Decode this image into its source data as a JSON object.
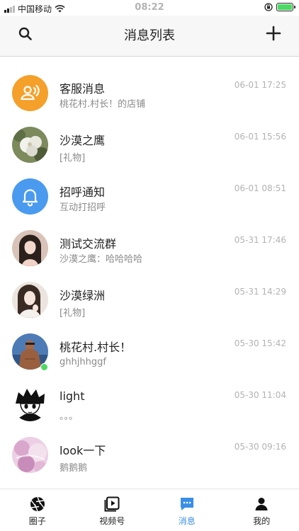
{
  "status_bar": {
    "carrier": "中国移动",
    "time": "08:22"
  },
  "nav": {
    "title": "消息列表",
    "search_icon": "search-icon",
    "add_icon": "plus-icon"
  },
  "messages": [
    {
      "name": "客服消息",
      "preview": "桃花村.村长！的店铺",
      "time": "06-01 17:25"
    },
    {
      "name": "沙漠之鹰",
      "preview": "[礼物]",
      "time": "06-01 15:56"
    },
    {
      "name": "招呼通知",
      "preview": "互动打招呼",
      "time": "06-01 08:51"
    },
    {
      "name": "测试交流群",
      "preview": "沙漠之鹰：哈哈哈哈",
      "time": "05-31 17:46"
    },
    {
      "name": "沙漠绿洲",
      "preview": "[礼物]",
      "time": "05-31 14:29"
    },
    {
      "name": "桃花村.村长！",
      "preview": "ghhjhhggf",
      "time": "05-30 15:42"
    },
    {
      "name": "light",
      "preview": "。。。",
      "time": "05-30 11:04"
    },
    {
      "name": "look一下",
      "preview": "鹅鹅鹅",
      "time": "05-30 09:16"
    }
  ],
  "tabs": [
    {
      "label": "圈子",
      "icon": "aperture-icon"
    },
    {
      "label": "视频号",
      "icon": "video-icon"
    },
    {
      "label": "消息",
      "icon": "chat-icon",
      "active": true
    },
    {
      "label": "我的",
      "icon": "person-icon"
    }
  ],
  "colors": {
    "accent": "#3a8ee6",
    "service_orange": "#f5a02a",
    "notify_blue": "#4a9bef",
    "online_green": "#4cd964"
  }
}
